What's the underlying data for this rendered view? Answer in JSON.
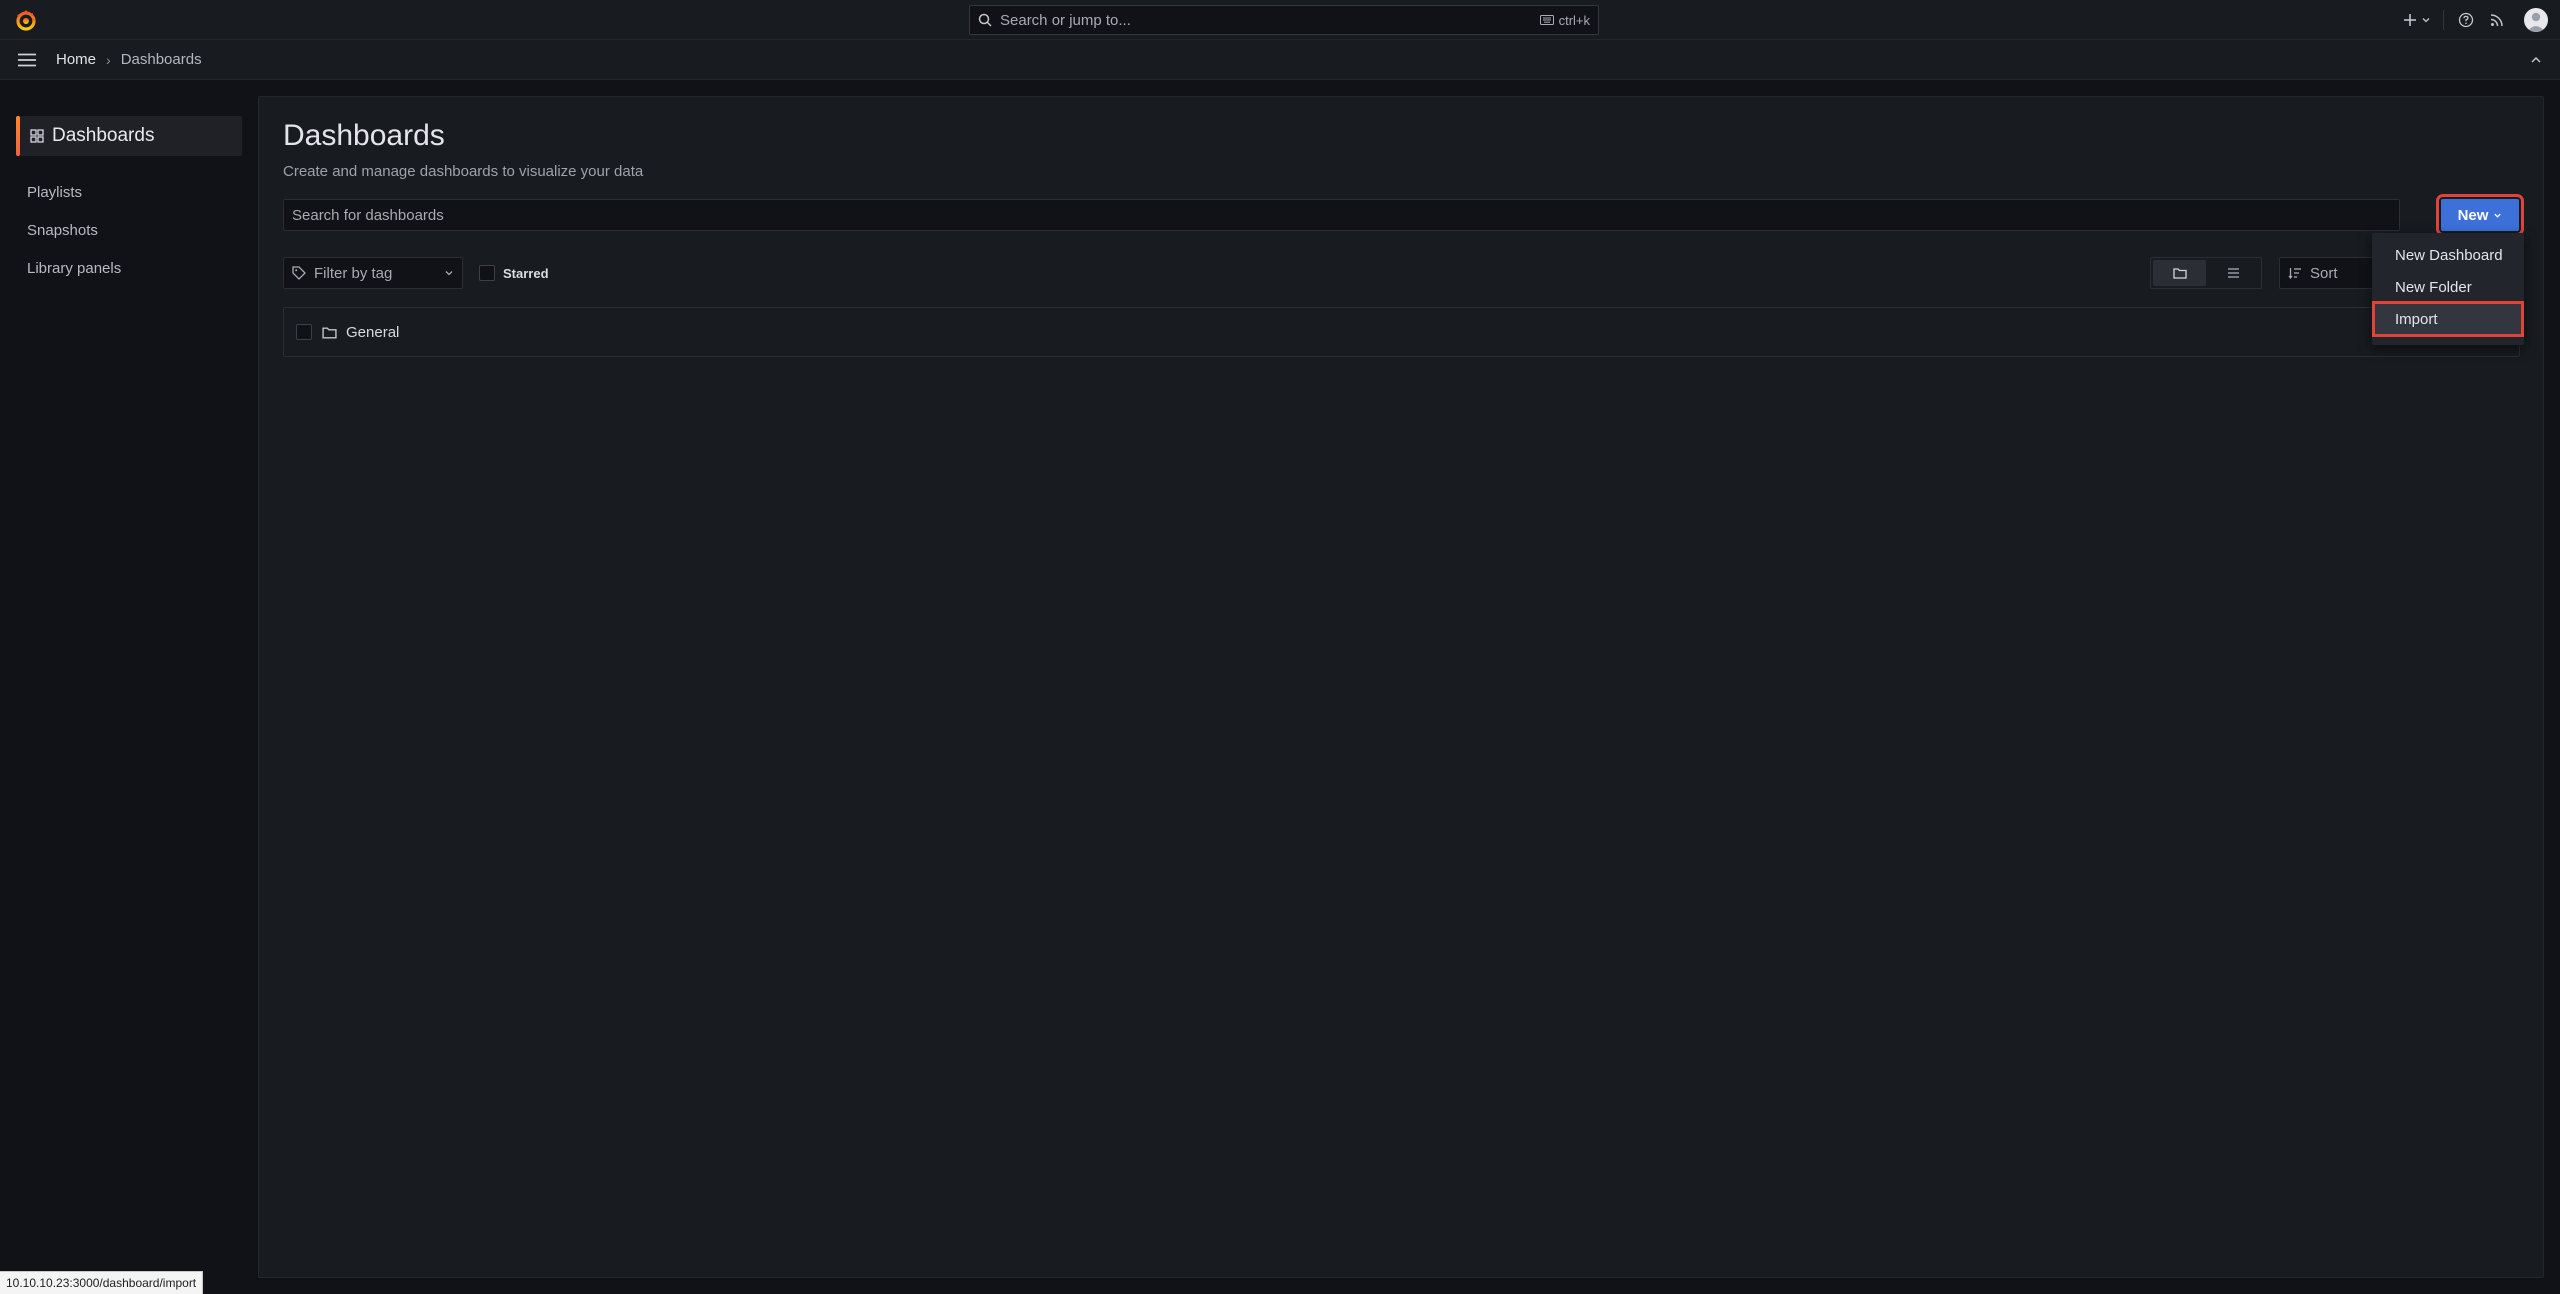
{
  "topbar": {
    "search_placeholder": "Search or jump to...",
    "shortcut": "ctrl+k",
    "icons": [
      "grafana-logo-icon",
      "plus-icon",
      "help-icon",
      "rss-icon",
      "avatar"
    ]
  },
  "breadcrumb": {
    "home": "Home",
    "separator": "›",
    "current": "Dashboards"
  },
  "sidebar": {
    "active": "Dashboards",
    "items": [
      "Playlists",
      "Snapshots",
      "Library panels"
    ]
  },
  "page": {
    "title": "Dashboards",
    "subtitle": "Create and manage dashboards to visualize your data",
    "search_placeholder": "Search for dashboards",
    "new_button": "New",
    "filter_tag_placeholder": "Filter by tag",
    "starred_label": "Starred",
    "sort_label": "Sort",
    "folders": [
      {
        "name": "General"
      }
    ]
  },
  "new_menu": {
    "items": [
      "New Dashboard",
      "New Folder",
      "Import"
    ],
    "highlighted": "Import"
  },
  "status_url": "10.10.10.23:3000/dashboard/import",
  "colors": {
    "background": "#111217",
    "panel": "#181b1f",
    "primary_button": "#3d71d9",
    "highlight_outline": "#e0433a",
    "brand": "#f55f3e"
  }
}
